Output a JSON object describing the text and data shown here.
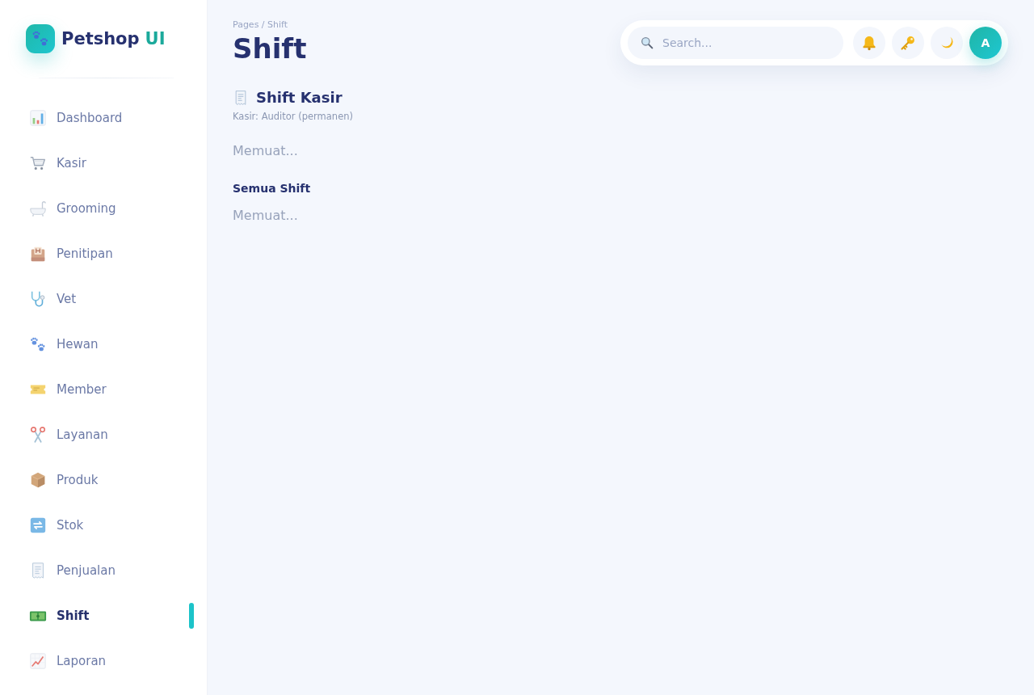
{
  "sidebar": {
    "brand": {
      "name": "Petshop",
      "suffix": "UI"
    },
    "items": [
      {
        "label": "Dashboard",
        "selected": false
      },
      {
        "label": "Kasir",
        "selected": false
      },
      {
        "label": "Grooming",
        "selected": false
      },
      {
        "label": "Penitipan",
        "selected": false
      },
      {
        "label": "Vet",
        "selected": false
      },
      {
        "label": "Hewan",
        "selected": false
      },
      {
        "label": "Member",
        "selected": false
      },
      {
        "label": "Layanan",
        "selected": false
      },
      {
        "label": "Produk",
        "selected": false
      },
      {
        "label": "Stok",
        "selected": false
      },
      {
        "label": "Penjualan",
        "selected": false
      },
      {
        "label": "Shift",
        "selected": true
      },
      {
        "label": "Laporan",
        "selected": false
      }
    ]
  },
  "header": {
    "breadcrumb": "Pages / Shift",
    "title": "Shift"
  },
  "topbar": {
    "search": {
      "placeholder": "Search..."
    },
    "avatar": {
      "initial": "A"
    }
  },
  "cashier_shift": {
    "title": "Shift Kasir",
    "cashier": "Kasir: Auditor (permanen)",
    "status": "Memuat..."
  },
  "all_shifts": {
    "title": "Semua Shift",
    "status": "Memuat..."
  }
}
